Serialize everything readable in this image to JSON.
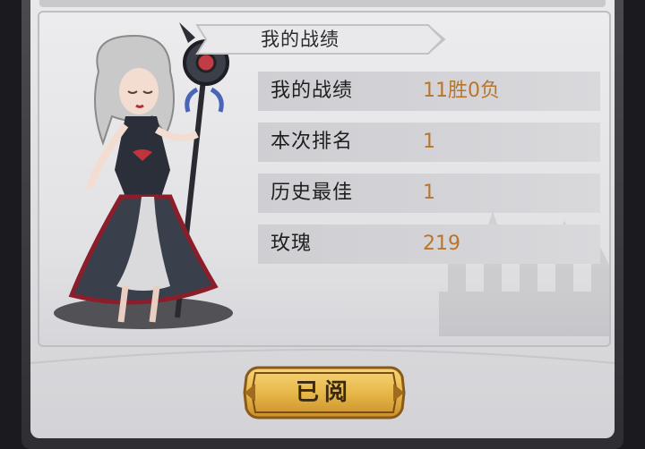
{
  "title_banner": {
    "text": "我的战绩"
  },
  "stats": [
    {
      "label": "我的战绩",
      "value": "11胜0负"
    },
    {
      "label": "本次排名",
      "value": "1"
    },
    {
      "label": "历史最佳",
      "value": "1"
    },
    {
      "label": "玫瑰",
      "value": "219"
    }
  ],
  "read_button": {
    "label": "已阅"
  },
  "colors": {
    "panel_bg": "#e6e6e8",
    "row_bg": "#d1d1d5",
    "value_text": "#b9752a",
    "button_gold": "#e8b84a",
    "button_border": "#8a5a1a"
  },
  "icons": [
    "character-portrait",
    "castle-silhouette",
    "staff-icon"
  ]
}
